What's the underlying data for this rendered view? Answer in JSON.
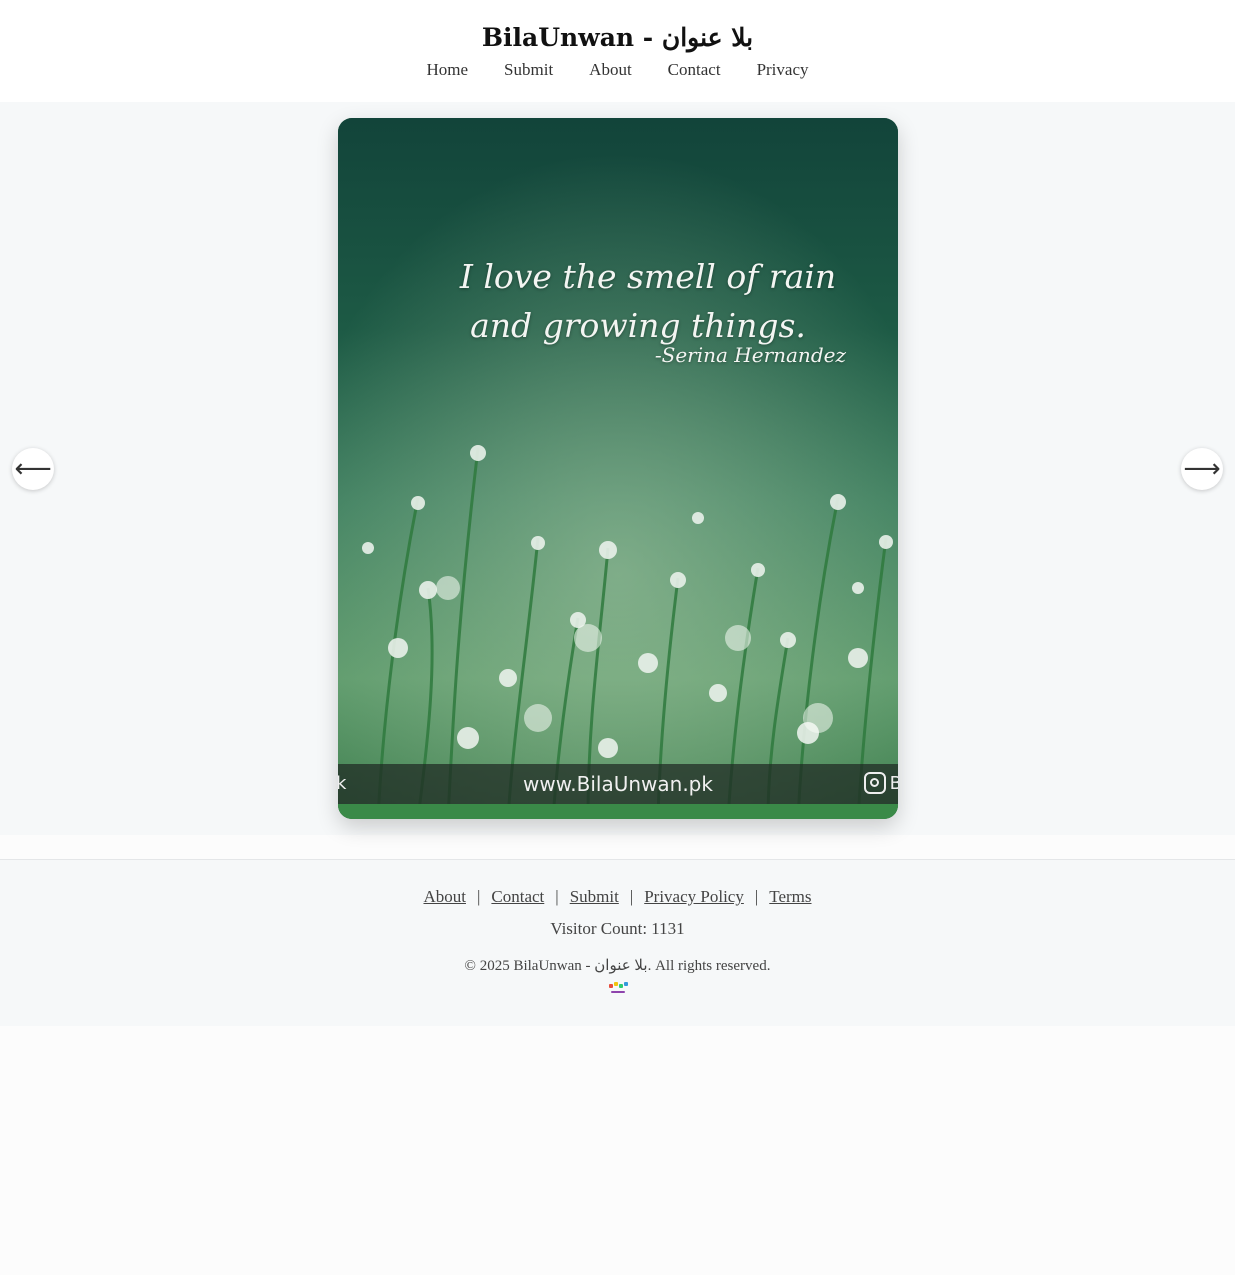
{
  "site": {
    "title": "BilaUnwan - بلا عنوان"
  },
  "nav": {
    "items": [
      "Home",
      "Submit",
      "About",
      "Contact",
      "Privacy"
    ]
  },
  "carousel": {
    "quote_line1": "I love the smell of rain",
    "quote_line2": "and growing things.",
    "quote_author": "-Serina Hernandez",
    "watermark_url": "www.BilaUnwan.pk",
    "watermark_left": "k",
    "watermark_right": "B",
    "prev_label": "⟵",
    "next_label": "⟶"
  },
  "footer": {
    "links": [
      "About",
      "Contact",
      "Submit",
      "Privacy Policy",
      "Terms"
    ],
    "separator": "|",
    "visitor_count": "Visitor Count: 1131",
    "copyright": "© 2025 BilaUnwan - بلا عنوان. All rights reserved."
  }
}
